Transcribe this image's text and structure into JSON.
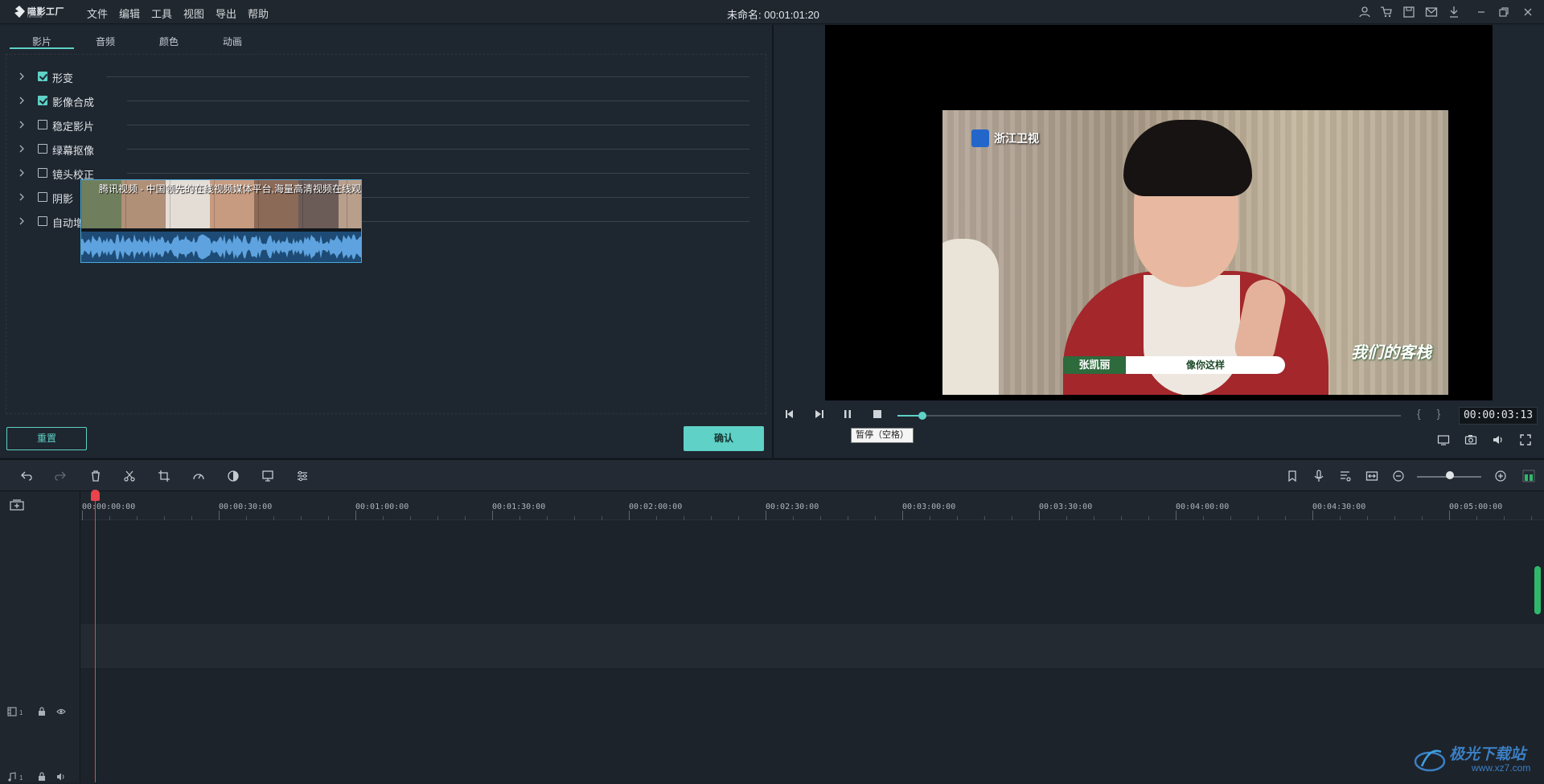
{
  "app": {
    "logo_text": "喵影工厂",
    "logo_sub": "filmora",
    "title": "未命名: 00:01:01:20",
    "menu": [
      "文件",
      "编辑",
      "工具",
      "视图",
      "导出",
      "帮助"
    ]
  },
  "props_panel": {
    "tabs": [
      "影片",
      "音频",
      "颜色",
      "动画"
    ],
    "active_tab": "影片",
    "items": [
      {
        "label": "形变",
        "checked": true
      },
      {
        "label": "影像合成",
        "checked": true
      },
      {
        "label": "稳定影片",
        "checked": false
      },
      {
        "label": "绿幕抠像",
        "checked": false
      },
      {
        "label": "镜头校正",
        "checked": false
      },
      {
        "label": "阴影",
        "checked": false
      },
      {
        "label": "自动增强",
        "checked": false
      }
    ],
    "reset_label": "重置",
    "confirm_label": "确认"
  },
  "preview": {
    "channel_name": "浙江卫视",
    "caption_name": "张凯丽",
    "caption_text": "像你这样",
    "show_logo": "我们的客栈",
    "timecode": "00:00:03:13",
    "brackets": "{ }",
    "tooltip": "暂停（空格）",
    "progress": 0.05
  },
  "timeline": {
    "ruler_labels": [
      "00:00:00:00",
      "00:00:30:00",
      "00:01:00:00",
      "00:01:30:00",
      "00:02:00:00",
      "00:02:30:00",
      "00:03:00:00",
      "00:03:30:00",
      "00:04:00:00",
      "00:04:30:00",
      "00:05:00:00"
    ],
    "video_track_num": "1",
    "audio_track_num": "1",
    "clip_title": "腾讯视频 - 中国领先的在线视频媒体平台,海量高清视频在线观看"
  },
  "watermark": {
    "text": "极光下载站",
    "url": "www.xz7.com"
  },
  "colors": {
    "accent": "#5fd1c7",
    "playhead": "#e9434b",
    "clip_border": "#4aa8d8"
  }
}
